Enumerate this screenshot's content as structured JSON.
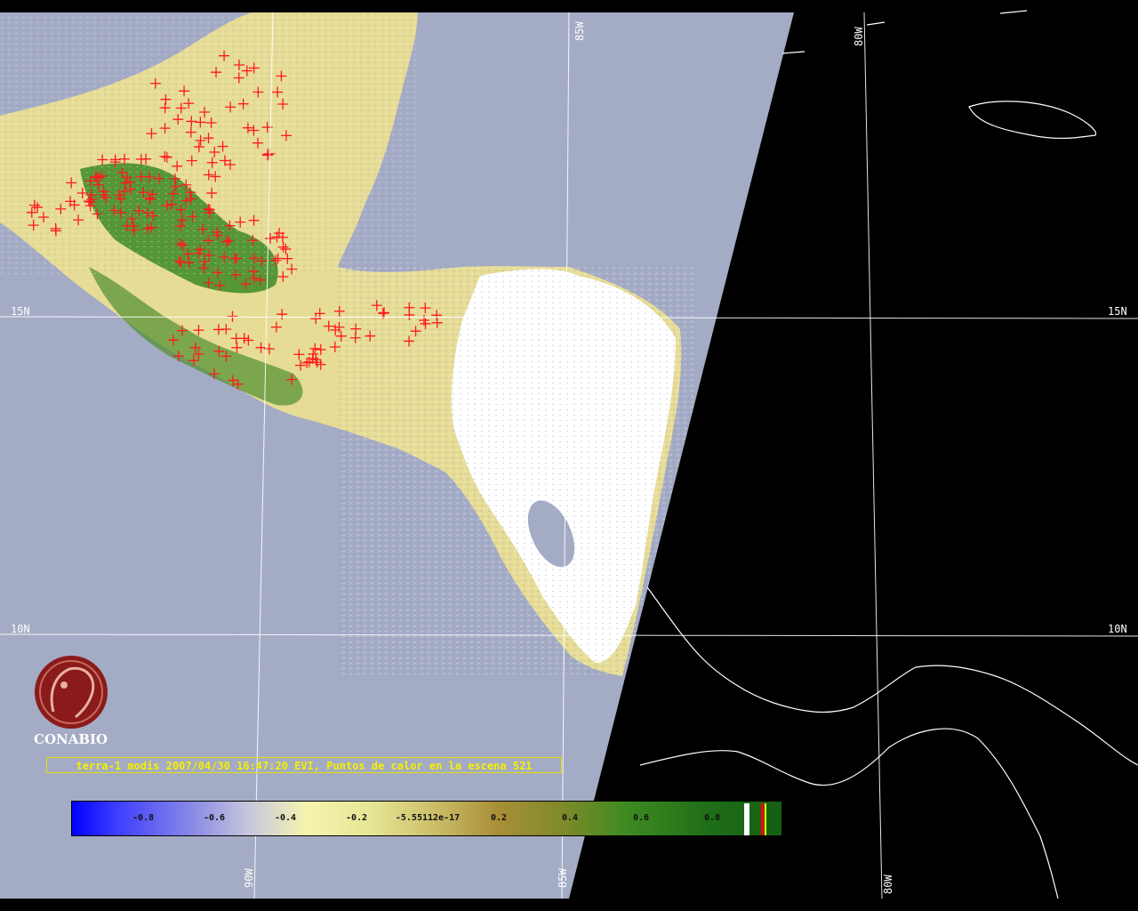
{
  "grid": {
    "lat_15": "15N",
    "lat_10": "10N",
    "lon_90": "90W",
    "lon_85": "85W",
    "lon_80": "80W"
  },
  "logo": {
    "text": "CONABIO"
  },
  "caption": "terra-1 modis 2007/04/30 16:47:20 EVI, Puntos de calor en la escena 521",
  "colorbar": {
    "ticks": [
      "-0.8",
      "-0.6",
      "-0.4",
      "-0.2",
      "-5.55112e-17",
      "0.2",
      "0.4",
      "0.6",
      "0.8"
    ]
  },
  "colors": {
    "ocean": "#a4abc4",
    "night": "#000000",
    "land_low": "#eeeec0",
    "land_mid": "#d4c97a",
    "land_high": "#2f7a1f",
    "cloud": "#ffffff",
    "fire": "#ff1a1a",
    "caption": "#f4f000",
    "logo": "#8b1a1a"
  }
}
